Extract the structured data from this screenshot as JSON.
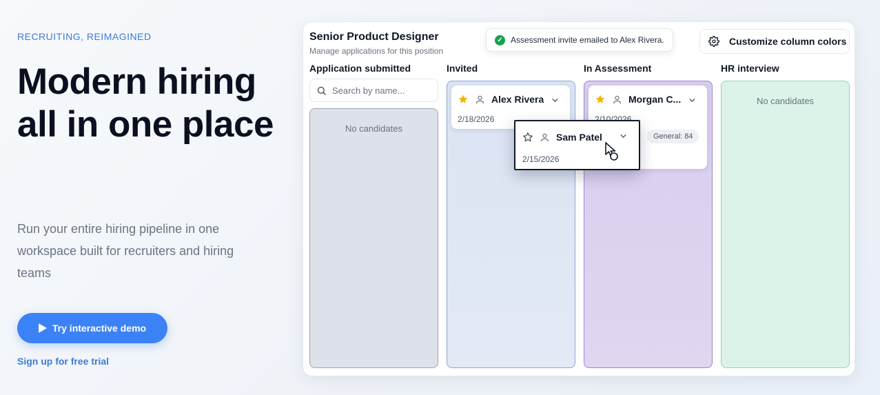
{
  "hero": {
    "eyebrow": "RECRUITING, REIMAGINED",
    "headline": "Modern hiring all in one place",
    "subtext": "Run your entire hiring pipeline in one workspace built for recruiters and hiring teams",
    "cta_label": "Try interactive demo",
    "cta_icon": "play-icon",
    "signup_label": "Sign up for free trial"
  },
  "board": {
    "title": "Senior Product Designer",
    "subtitle": "Manage applications for this position",
    "toast": "Assessment invite emailed to Alex Rivera.",
    "customize_label": "Customize column colors",
    "search_placeholder": "Search by name...",
    "columns": [
      {
        "name": "Application submitted",
        "empty_label": "No candidates",
        "color": "#dde1e9"
      },
      {
        "name": "Invited",
        "color": "#dbe4f4"
      },
      {
        "name": "In Assessment",
        "color": "#ddd4ee"
      },
      {
        "name": "HR interview",
        "empty_label": "No candidates",
        "color": "#dcf3e9"
      }
    ],
    "cards": [
      {
        "name": "Alex Rivera",
        "date": "2/18/2026",
        "starred": true
      },
      {
        "name": "Morgan C...",
        "date": "2/10/2026",
        "starred": true,
        "tag": "General: 84"
      }
    ],
    "dragging_card": {
      "name": "Sam Patel",
      "date": "2/15/2026",
      "starred": false
    }
  },
  "colors": {
    "accent": "#3b82f6",
    "star": "#f5b400",
    "success": "#16a34a"
  }
}
